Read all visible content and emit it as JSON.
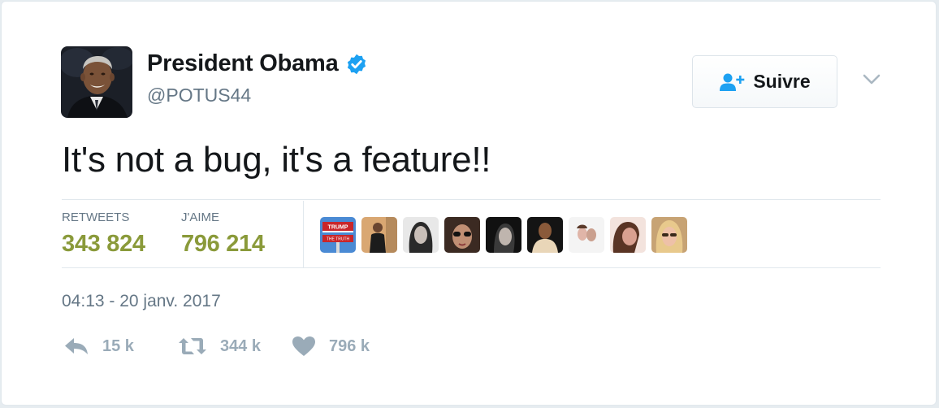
{
  "user": {
    "name": "President Obama",
    "handle": "@POTUS44",
    "verified": true
  },
  "follow_button": {
    "label": "Suivre",
    "icon": "follow-user-plus-icon"
  },
  "menu": {
    "icon": "chevron-down-icon"
  },
  "tweet": {
    "text": "It's not a bug, it's a feature!!"
  },
  "stats": {
    "retweets_label": "RETWEETS",
    "retweets_value": "343 824",
    "likes_label": "J'AIME",
    "likes_value": "796 214"
  },
  "liked_by_avatars": [
    {
      "name": "avatar-sign",
      "sign_text_top": "TRUMP",
      "sign_text_bottom": "THE TRUTH"
    },
    {
      "name": "avatar-man-standing"
    },
    {
      "name": "avatar-woman-1"
    },
    {
      "name": "avatar-woman-sunglasses"
    },
    {
      "name": "avatar-woman-2"
    },
    {
      "name": "avatar-man"
    },
    {
      "name": "avatar-couple"
    },
    {
      "name": "avatar-woman-3"
    },
    {
      "name": "avatar-woman-blonde"
    }
  ],
  "timestamp": "04:13 - 20 janv. 2017",
  "actions": {
    "reply": {
      "icon": "reply-icon",
      "count": "15 k"
    },
    "retweet": {
      "icon": "retweet-icon",
      "count": "344 k"
    },
    "like": {
      "icon": "heart-icon",
      "count": "796 k"
    }
  },
  "colors": {
    "stat_value": "#8a9a3a",
    "verified_blue": "#1da1f2",
    "secondary_text": "#657786",
    "action_gray": "#9aabb8"
  }
}
